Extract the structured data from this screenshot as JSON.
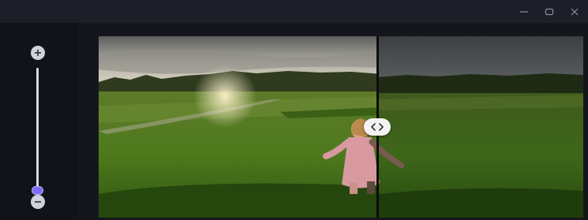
{
  "window": {
    "controls": {
      "minimize_icon": "minimize-icon",
      "maximize_icon": "maximize-icon",
      "close_icon": "close-icon"
    }
  },
  "zoom": {
    "plus_icon": "plus-icon",
    "minus_icon": "minus-icon",
    "level": 0.0
  },
  "comparison": {
    "split_fraction": 0.575,
    "handle_icon": "chevrons-left-right-icon",
    "left_label": "",
    "right_label": ""
  },
  "colors": {
    "accent": "#7b6cf5",
    "titlebar": "#1c1f27",
    "sidebar": "#111318",
    "background": "#14161b"
  }
}
